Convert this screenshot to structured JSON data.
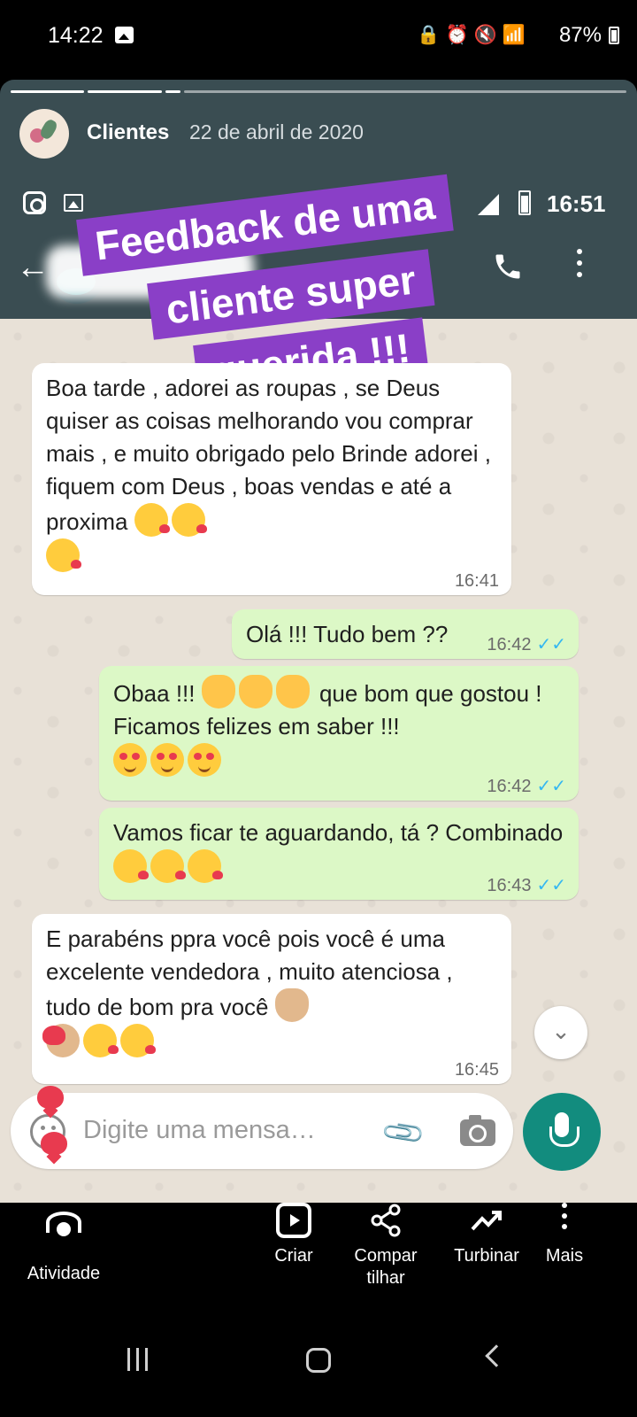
{
  "status_bar": {
    "time": "14:22",
    "battery": "87%",
    "icons": [
      "gallery-icon",
      "lock-icon",
      "alarm-icon",
      "mute-icon",
      "wifi-icon",
      "volte-icon",
      "signal-icon",
      "battery-icon"
    ],
    "volte_label": "Vo)) LTE1"
  },
  "story": {
    "account_name": "Clientes",
    "date": "22 de abril de 2020",
    "progress_segments": 4,
    "progress_current": 3,
    "sticker_lines": [
      "Feedback de uma",
      "cliente super",
      "querida !!!"
    ],
    "sticker_color": "#8a3fc7"
  },
  "embedded_screenshot": {
    "status_time": "16:51",
    "chat": {
      "messages": [
        {
          "direction": "in",
          "text": "Boa tarde , adorei as roupas , se Deus quiser as coisas melhorando  vou comprar mais , e muito obrigado pelo Brinde  adorei , fiquem com Deus , boas vendas e até  a proxima",
          "time": "16:41"
        },
        {
          "direction": "out",
          "text": "Olá !!! Tudo bem ??",
          "time": "16:42"
        },
        {
          "direction": "out",
          "text_a": "Obaa !!!",
          "text_b": "que bom que gostou ! Ficamos felizes em saber !!!",
          "time": "16:42"
        },
        {
          "direction": "out",
          "text": "Vamos ficar te aguardando, tá ? Combinado",
          "time": "16:43"
        },
        {
          "direction": "in",
          "text": "E parabéns  ppra você  pois você  é uma excelente vendedora , muito atenciosa , tudo de bom pra você",
          "time": "16:45"
        }
      ],
      "input_placeholder": "Digite uma mensa…",
      "colors": {
        "incoming": "#ffffff",
        "outgoing": "#dcf8c6",
        "header": "#3a4d52",
        "mic": "#128c7e",
        "ticks": "#34b7f1"
      }
    }
  },
  "actions": {
    "atividade": "Atividade",
    "criar": "Criar",
    "compartilhar_1": "Compar",
    "compartilhar_2": "tilhar",
    "turbinar": "Turbinar",
    "mais": "Mais"
  }
}
